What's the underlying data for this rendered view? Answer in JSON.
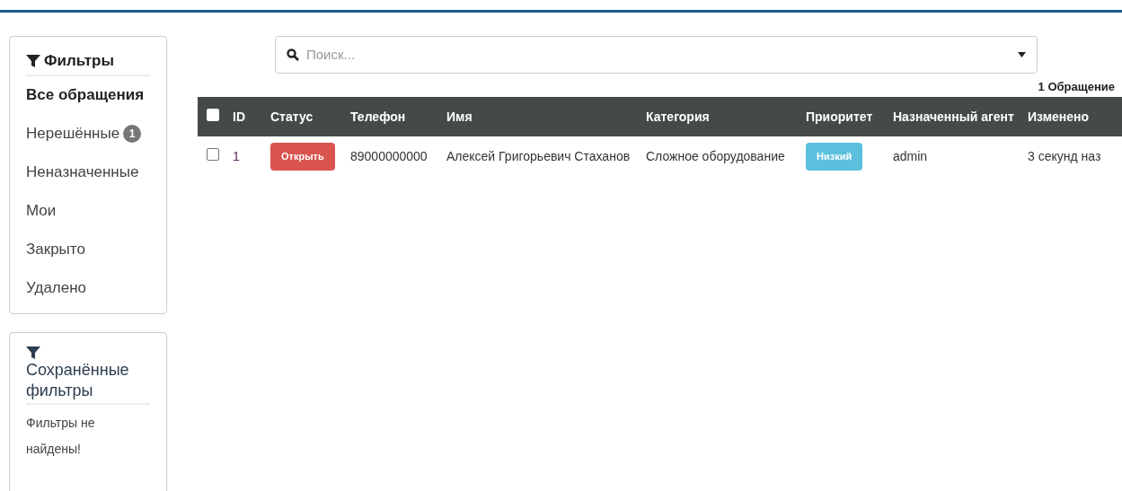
{
  "filters_panel": {
    "title": "Фильтры",
    "items": [
      {
        "label": "Все обращения",
        "selected": true
      },
      {
        "label": "Нерешённые",
        "selected": false,
        "badge": "1"
      },
      {
        "label": "Неназначенные",
        "selected": false
      },
      {
        "label": "Мои",
        "selected": false
      },
      {
        "label": "Закрыто",
        "selected": false
      },
      {
        "label": "Удалено",
        "selected": false
      }
    ]
  },
  "saved_filters_panel": {
    "title": "Сохранённые фильтры",
    "empty_message": "Фильтры не найдены!"
  },
  "search": {
    "placeholder": "Поиск..."
  },
  "result_count": "1 Обращение",
  "table": {
    "select_all": {
      "checked": false
    },
    "columns": [
      "ID",
      "Статус",
      "Телефон",
      "Имя",
      "Категория",
      "Приоритет",
      "Назначенный агент",
      "Изменено"
    ],
    "rows": [
      {
        "checked": false,
        "id": "1",
        "status": {
          "label": "Открыть",
          "color": "#d9534f"
        },
        "phone": "89000000000",
        "name": "Алексей Григорьевич Стаханов",
        "category": "Сложное оборудование",
        "priority": {
          "label": "Низкий",
          "color": "#5bc0de"
        },
        "agent": "admin",
        "modified": "3 секунд наз"
      }
    ]
  }
}
